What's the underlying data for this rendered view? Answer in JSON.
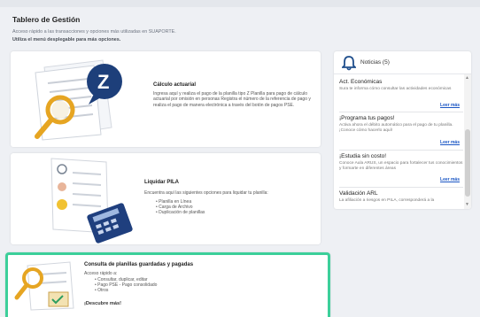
{
  "page": {
    "title": "Tablero de Gestión",
    "description": "Acceso rápido a las transacciones y opciones más utilizadas en SUAPORTE.",
    "hint": "Utiliza el menú desplegable para más opciones."
  },
  "cards": {
    "actuarial": {
      "title": "Cálculo actuarial",
      "text": "Ingresa aquí y realiza el pago de la planilla tipo Z Planilla para pago de cálculo actuarial por omisión en personas Registra el número de la referencia de pago y realiza el pago de manera electrónica a través del botón de pagos PSE."
    },
    "pila": {
      "title": "Liquidar PILA",
      "text": "Encuentra aquí las siguientes opciones para liquidar tu planilla:",
      "items": [
        "Planilla en Línea",
        "Carga de Archivo",
        "Duplicación de planillas"
      ]
    },
    "consulta": {
      "title": "Consulta de planillas guardadas y pagadas",
      "intro": "Acceso rápido a:",
      "items": [
        "Consultar, duplicar, editar",
        "Pago PSE - Pago consolidado",
        "Otros"
      ],
      "more": "¡Descubre más!"
    }
  },
  "news": {
    "title": "Noticias (5)",
    "more_label": "Leer más",
    "items": [
      {
        "title": "Act. Económicas",
        "text": "Sura te informa cómo consultar las actividades económicas"
      },
      {
        "title": "¡Programa tus pagos!",
        "text": "Activa ahora el débito automático para el pago de tu planilla. ¡Conoce cómo hacerlo aquí!"
      },
      {
        "title": "¡Estudia sin costo!",
        "text": "Conoce Aula ARUS, un espacio para fortalecer tus conocimientos y formarte en diferentes áreas"
      },
      {
        "title": "Validación ARL",
        "text": "La afiliación a riesgos en PILA, corresponderá a la"
      }
    ]
  },
  "colors": {
    "highlight_border": "#3ccf9a",
    "news_bell": "#1f4e8c",
    "link": "#1a56c4",
    "z_bubble": "#1d3f7a"
  },
  "icons": {
    "bell": "bell-icon",
    "scroll_up": "chevron-up-icon",
    "scroll_down": "chevron-down-icon"
  }
}
